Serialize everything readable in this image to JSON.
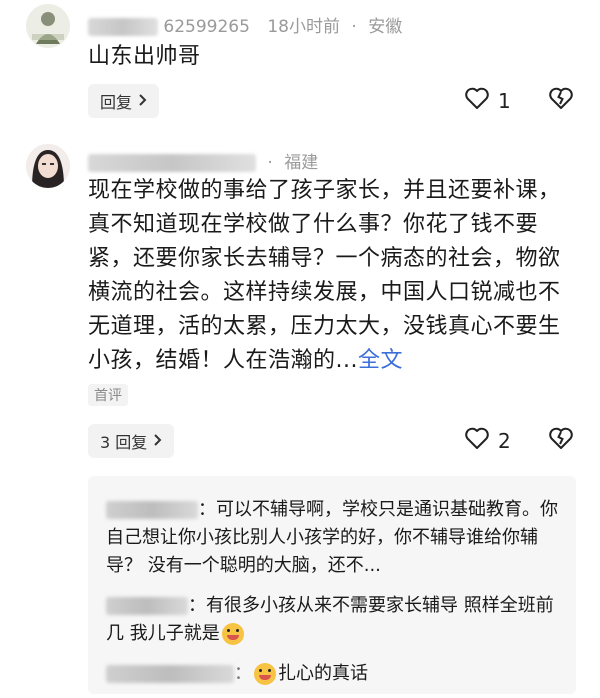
{
  "comments": [
    {
      "user_suffix": "62599265",
      "time": "18小时前",
      "location": "安徽",
      "text": "山东出帅哥",
      "reply_label": "回复",
      "like_count": "1"
    },
    {
      "user_suffix": "",
      "location": "福建",
      "text": "现在学校做的事给了孩子家长，并且还要补课，真不知道现在学校做了什么事？你花了钱不要紧，还要你家长去辅导？一个病态的社会，物欲横流的社会。这样持续发展，中国人口锐减也不无道理，活的太累，压力太大，没钱真心不要生小孩，结婚！人在浩瀚的...",
      "more_label": "全文",
      "tag": "首评",
      "reply_label": "3 回复",
      "like_count": "2"
    }
  ],
  "sub_replies": [
    {
      "text": "：可以不辅导啊，学校只是通识基础教育。你自己想让你小孩比别人小孩学的好，你不辅导谁给你辅导？ 没有一个聪明的大脑，还不..."
    },
    {
      "text": "：有很多小孩从来不需要家长辅导 照样全班前几 我儿子就是"
    },
    {
      "text": "扎心的真话"
    }
  ],
  "icons": {
    "heart": "heart-icon",
    "dislike": "dislike-icon",
    "chevron": "chevron-right-icon",
    "emoji": "emoji-icon"
  },
  "colors": {
    "link": "#3c6fd8",
    "meta": "#9a9a9a"
  }
}
